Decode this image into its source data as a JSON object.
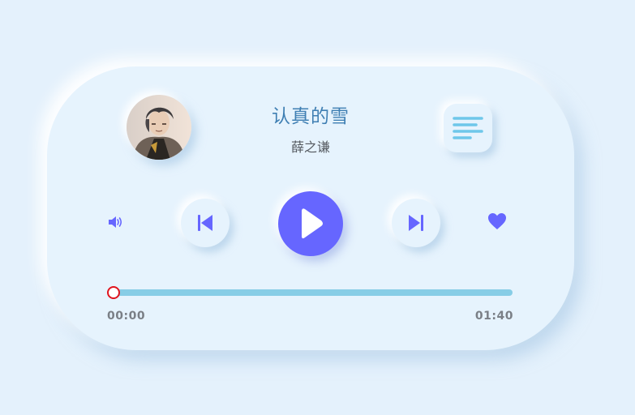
{
  "song": {
    "title": "认真的雪",
    "artist": "薛之谦"
  },
  "player": {
    "current_time": "00:00",
    "total_time": "01:40",
    "progress": 0.0
  },
  "icons": {
    "volume": "volume-icon",
    "prev": "skip-previous-icon",
    "play": "play-icon",
    "next": "skip-next-icon",
    "like": "heart-icon",
    "menu": "menu-lines-icon"
  },
  "colors": {
    "background": "#e4f1fc",
    "accent": "#6666ff",
    "title": "#3f7fb3",
    "menu_lines": "#6ec7ea",
    "progress_track": "#87cde6",
    "knob_border": "#e0141e"
  }
}
